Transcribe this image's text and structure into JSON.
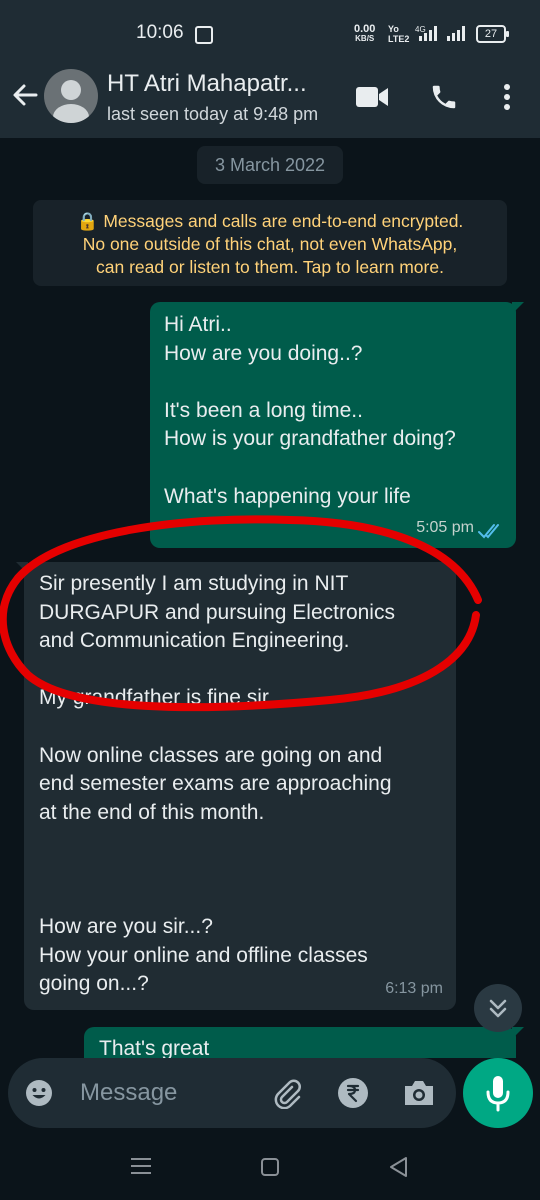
{
  "status_bar": {
    "time": "10:06",
    "speed_top": "0.00",
    "speed_bottom": "KB/S",
    "volte_top": "Yo",
    "volte_bottom": "LTE2",
    "network": "4G",
    "battery": "27"
  },
  "header": {
    "name": "HT Atri Mahapatr...",
    "status": "last seen today at 9:48 pm"
  },
  "chat": {
    "date": "3 March 2022",
    "encryption_notice": [
      "🔒 Messages and calls are end-to-end encrypted.",
      "No one outside of this chat, not even WhatsApp,",
      "can read or listen to them. Tap to learn more."
    ],
    "messages": [
      {
        "direction": "outgoing",
        "lines": [
          "Hi Atri..",
          "How are you doing..?",
          "",
          "It's been a long time..",
          "How is your grandfather doing?",
          "",
          "What's happening your life"
        ],
        "time": "5:05 pm",
        "status": "read"
      },
      {
        "direction": "incoming",
        "lines": [
          "Sir presently I am studying in NIT",
          "DURGAPUR and pursuing Electronics",
          "and Communication Engineering.",
          "",
          "My grandfather is fine sir.....",
          "",
          "Now online classes are going on and",
          "end semester exams are approaching",
          "at the end of this month.",
          "",
          "",
          "",
          "How are you sir...?",
          "How your online and offline classes",
          "going on...?"
        ],
        "time": "6:13 pm"
      },
      {
        "direction": "outgoing",
        "lines": [
          "That's great"
        ]
      }
    ]
  },
  "composer": {
    "placeholder": "Message"
  },
  "colors": {
    "annotation": "#e50000",
    "accent": "#00a884",
    "read_ticks": "#53bdeb"
  }
}
